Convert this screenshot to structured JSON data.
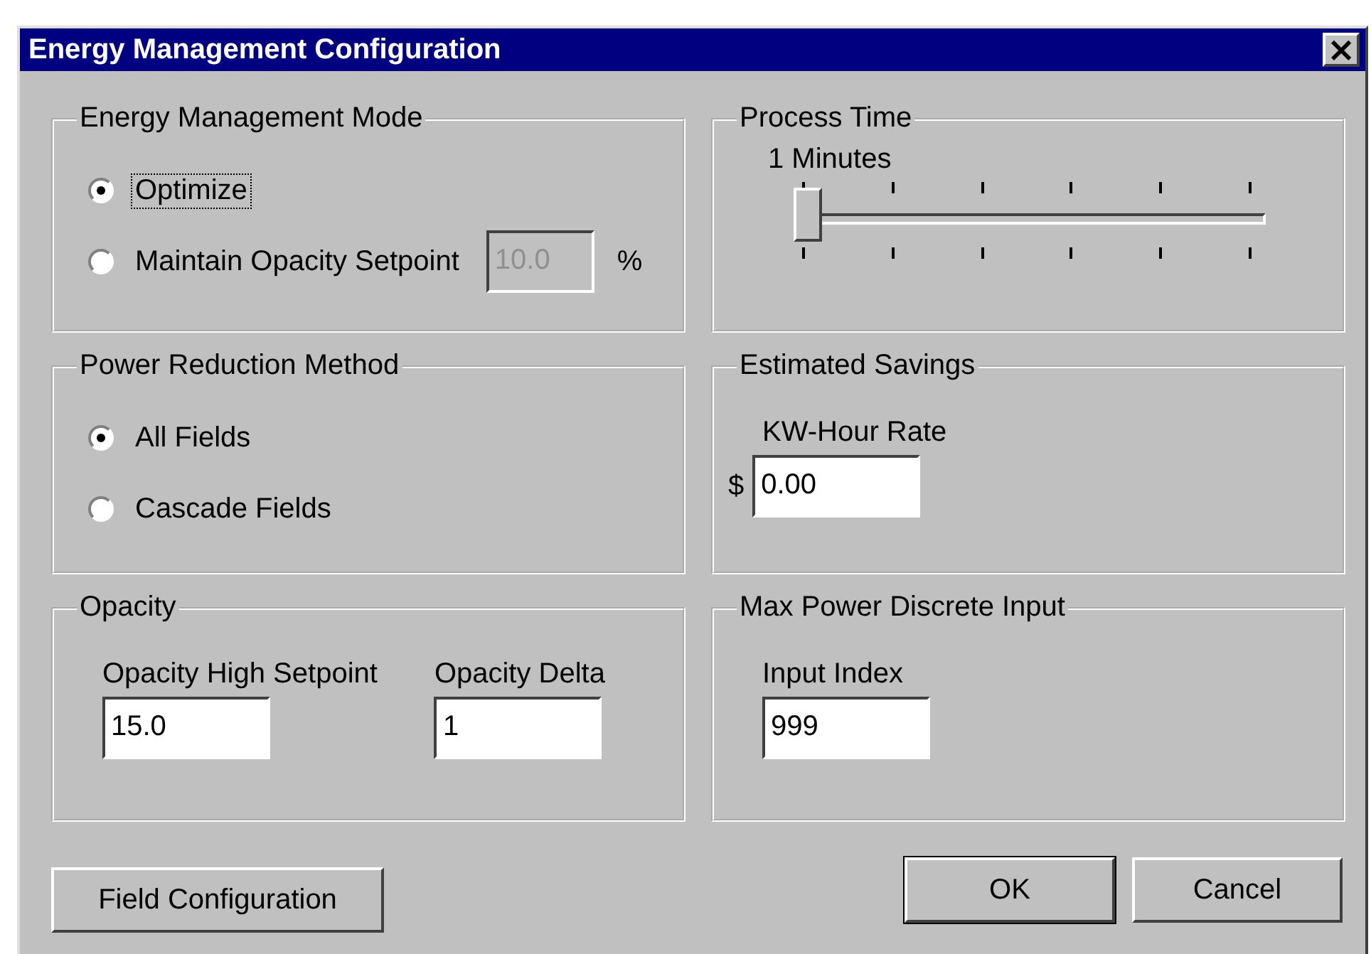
{
  "window": {
    "title": "Energy Management Configuration",
    "close": "×"
  },
  "groups": [
    {
      "kind": "radios",
      "title": "Energy Management Mode",
      "options": [
        {
          "label": "Optimize",
          "selected": true,
          "focused": true
        },
        {
          "label": "Maintain Opacity Setpoint",
          "selected": false,
          "field": {
            "value": "10.0",
            "disabled": true
          },
          "unit": "%"
        }
      ]
    },
    {
      "kind": "slider",
      "title": "Process Time",
      "reading": "1 Minutes",
      "level": 0
    },
    {
      "kind": "radios",
      "title": "Power Reduction Method",
      "options": [
        {
          "label": "All Fields",
          "selected": true,
          "focused": false
        },
        {
          "label": "Cascade Fields",
          "selected": false
        }
      ]
    },
    {
      "kind": "fields",
      "title": "Estimated Savings",
      "fields": [
        {
          "label": "KW-Hour Rate",
          "prefix": "$",
          "value": "0.00"
        }
      ]
    },
    {
      "kind": "fields",
      "title": "Opacity",
      "fields": [
        {
          "label": "Opacity High Setpoint",
          "value": "15.0"
        },
        {
          "label": "Opacity Delta",
          "value": "1"
        }
      ]
    },
    {
      "kind": "fields",
      "title": "Max Power Discrete Input",
      "fields": [
        {
          "label": "Input Index",
          "value": "999"
        }
      ]
    }
  ],
  "buttons": [
    {
      "label": "Field Configuration",
      "default": false
    },
    {
      "label": "OK",
      "default": true
    },
    {
      "label": "Cancel",
      "default": false
    }
  ]
}
